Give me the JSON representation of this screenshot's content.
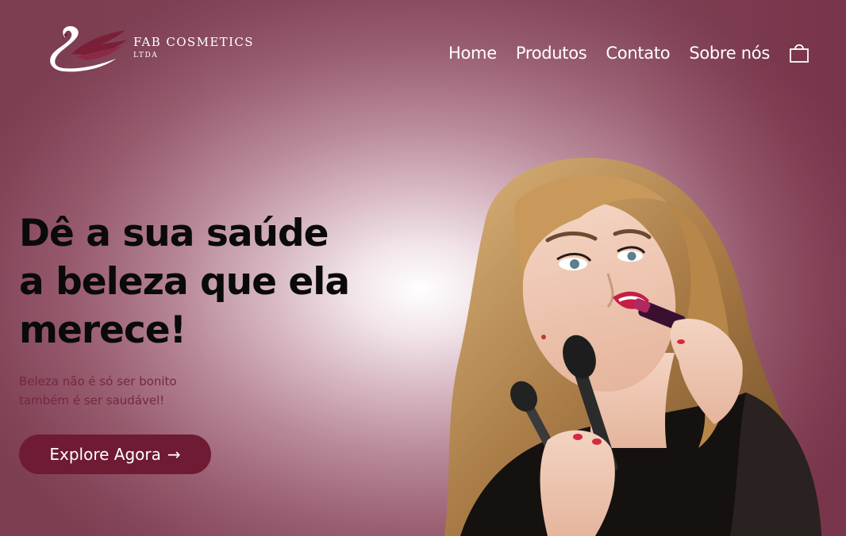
{
  "brand": {
    "name": "FAB COSMETICS",
    "suffix": "LTDA",
    "logo_icon": "swan-logo-icon"
  },
  "nav": {
    "items": [
      "Home",
      "Produtos",
      "Contato",
      "Sobre nós"
    ],
    "cart_icon": "shopping-bag-icon"
  },
  "hero": {
    "title_line1": "Dê a sua saúde",
    "title_line2": "a beleza que ela",
    "title_line3": "merece!",
    "subtitle_line1": "Beleza não é só ser bonito",
    "subtitle_line2": "também é ser saudável!",
    "cta_label": "Explore Agora",
    "cta_arrow": "→"
  },
  "colors": {
    "accent": "#6e1b33",
    "subtitle": "#74283f",
    "background_edge": "#8a4a5e",
    "background_center": "#ffffff"
  }
}
